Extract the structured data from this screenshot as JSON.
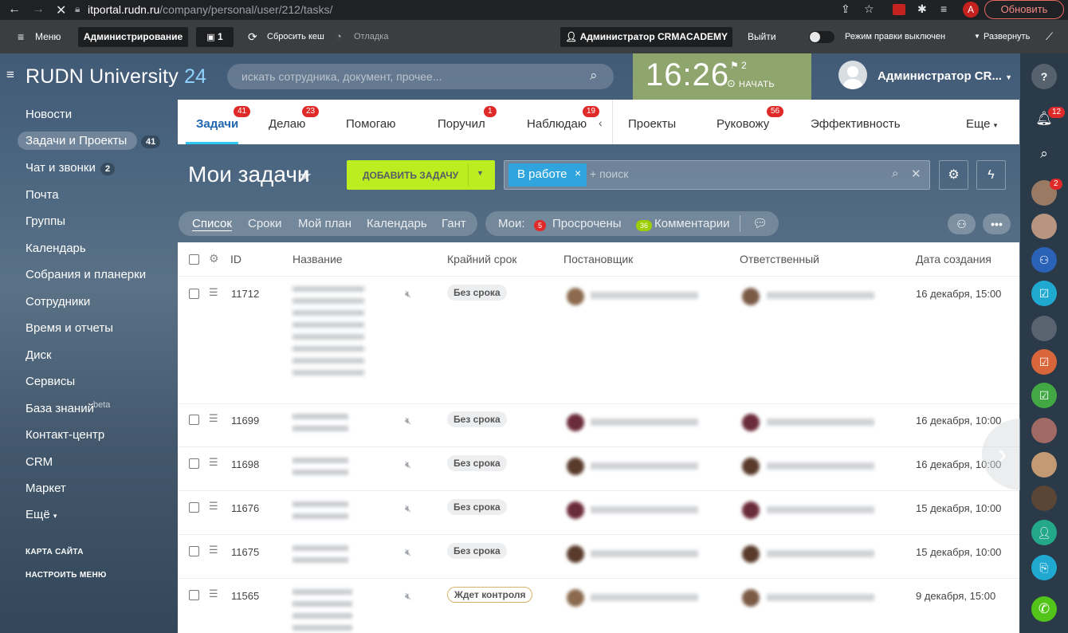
{
  "browser": {
    "url_host": "itportal.rudn.ru",
    "url_path": "/company/personal/user/212/tasks/",
    "avatar_letter": "A",
    "update_label": "Обновить"
  },
  "adminbar": {
    "menu": "Меню",
    "admin": "Администрирование",
    "count": "1",
    "clear_cache": "Сбросить кеш",
    "debug": "Отладка",
    "user": "Администратор CRMACADEMY",
    "logout": "Выйти",
    "edit_mode": "Режим правки выключен",
    "expand": "Развернуть"
  },
  "header": {
    "logo_main": "RUDN University",
    "logo_num": "24",
    "search_placeholder": "искать сотрудника, документ, прочее...",
    "clock": "16:26",
    "flag_count": "2",
    "start": "НАЧАТЬ",
    "user": "Администратор CR..."
  },
  "menu": {
    "items": [
      "Новости",
      "Задачи и Проекты",
      "Чат и звонки",
      "Почта",
      "Группы",
      "Календарь",
      "Собрания и планерки",
      "Сотрудники",
      "Время и отчеты",
      "Диск",
      "Сервисы",
      "База знаний",
      "Контакт-центр",
      "CRM",
      "Маркет",
      "Ещё"
    ],
    "tasks_count": "41",
    "chat_count": "2",
    "beta": "beta",
    "sitemap": "КАРТА САЙТА",
    "configure": "НАСТРОИТЬ МЕНЮ"
  },
  "tabs": {
    "items": [
      {
        "label": "Задачи",
        "badge": "41"
      },
      {
        "label": "Делаю",
        "badge": "23"
      },
      {
        "label": "Помогаю",
        "badge": ""
      },
      {
        "label": "Поручил",
        "badge": "1"
      },
      {
        "label": "Наблюдаю",
        "badge": "19"
      },
      {
        "label": "Проекты",
        "badge": ""
      },
      {
        "label": "Руковожу",
        "badge": "56"
      },
      {
        "label": "Эффективность",
        "badge": ""
      },
      {
        "label": "Еще",
        "badge": ""
      }
    ]
  },
  "page": {
    "title": "Мои задачи",
    "add_task": "ДОБАВИТЬ ЗАДАЧУ",
    "filter_chip": "В работе",
    "filter_placeholder": "+ поиск"
  },
  "views": {
    "items": [
      "Список",
      "Сроки",
      "Мой план",
      "Календарь",
      "Гант"
    ],
    "my": "Мои:",
    "overdue_count": "5",
    "overdue": "Просрочены",
    "comments_count": "36",
    "comments": "Комментарии"
  },
  "table": {
    "headers": [
      "ID",
      "Название",
      "Крайний срок",
      "Постановщик",
      "Ответственный",
      "Дата создания"
    ],
    "rows": [
      {
        "id": "11712",
        "status": "Без срока",
        "date": "16 декабря, 15:00"
      },
      {
        "id": "11699",
        "status": "Без срока",
        "date": "16 декабря, 10:00"
      },
      {
        "id": "11698",
        "status": "Без срока",
        "date": "16 декабря, 10:00"
      },
      {
        "id": "11676",
        "status": "Без срока",
        "date": "15 декабря, 10:00"
      },
      {
        "id": "11675",
        "status": "Без срока",
        "date": "15 декабря, 10:00"
      },
      {
        "id": "11565",
        "status": "Ждет контроля",
        "date": "9 декабря, 15:00"
      }
    ]
  },
  "rightbar": {
    "notif_count": "12",
    "chat_badge": "2"
  },
  "colors": {
    "accent": "#2fc6f6",
    "add_button": "#bbed21",
    "badge": "#e02a2a",
    "timebox": "#8ea56e",
    "chip": "#2fa4dd"
  }
}
